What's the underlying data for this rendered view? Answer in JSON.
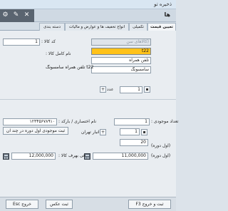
{
  "window": {
    "title": "ذخیره تو"
  },
  "toolbar": {
    "title": "ها",
    "icons": [
      "gear-icon",
      "wrench-icon",
      "close-icon"
    ]
  },
  "tabs": [
    {
      "label": "دسته بندی"
    },
    {
      "label": "انواع تخفیف ها و عوارض و مالیات"
    },
    {
      "label": "تکمیلی"
    },
    {
      "label": "تعیین قیمت"
    }
  ],
  "form": {
    "code_value": "1",
    "code_label": "کد کالا :",
    "secondary_placeholder": "(کالاهای سن",
    "full_name_label": "نام کامل کالا :",
    "name_value": "t22",
    "field2_value": "تلفن همراه",
    "field3_value": "سامسونگ",
    "full_name_display": "t22 تلفن همراه سامسونگ",
    "count_value": "1",
    "count_label": "عدد",
    "barcode_label": "نام اختصاری / بارکد :",
    "barcode_value": "۱۲۳۴۵۶۷۸۹۱۰",
    "initial_stock_label": "تعداد موجودی :",
    "initial_stock_value": "1",
    "save_initial_stock_label": "ثبت موجودی اول دوره در چند ان",
    "warehouse_label": "انبار تهران",
    "warehouse_value": "1",
    "period_value": "20",
    "period_label": "(اول دوره)",
    "purchase_label": "(اول دوره)",
    "purchase_price_value": "11,000,000",
    "sale_label": "فی بهرف کالا :",
    "sale_price_value": "12,000,000"
  },
  "footer": {
    "save_exit_label": "ثبت و خروج F3",
    "photo_label": "ثبت عکس",
    "exit_label": "خروج Esc"
  }
}
